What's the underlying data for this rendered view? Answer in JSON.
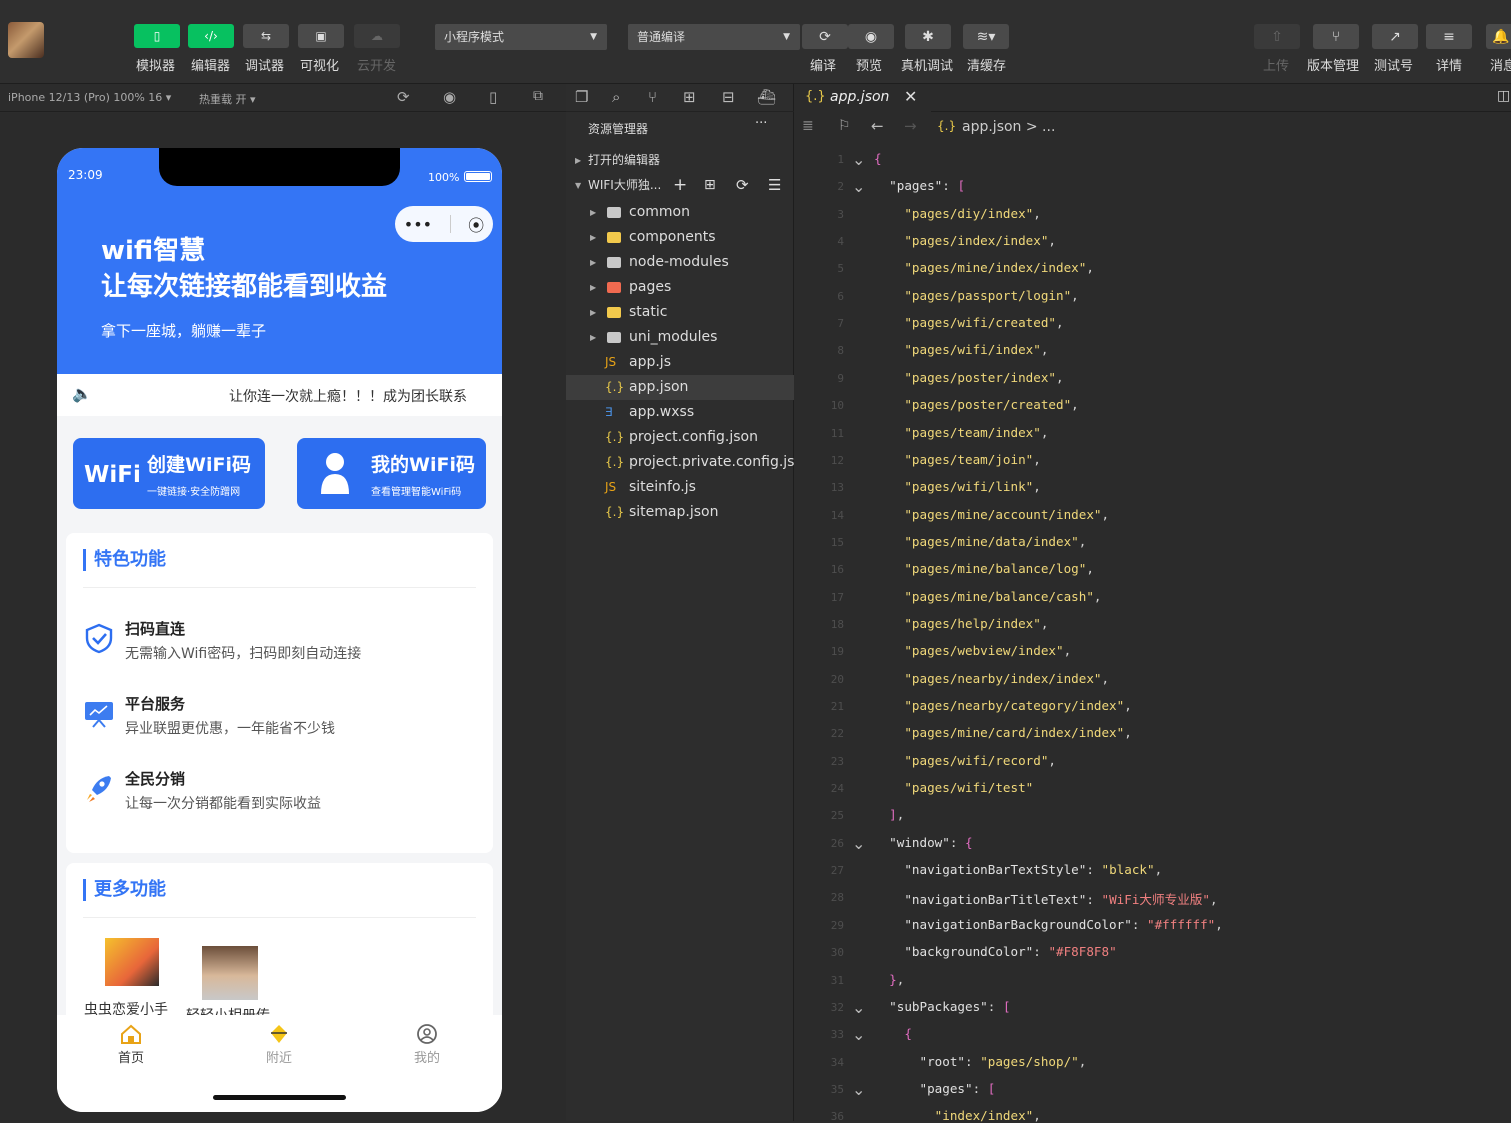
{
  "toolbar": {
    "buttons": [
      {
        "label": "模拟器",
        "icon": "phone-icon"
      },
      {
        "label": "编辑器",
        "icon": "code-icon"
      },
      {
        "label": "调试器",
        "icon": "debug-icon"
      },
      {
        "label": "可视化",
        "icon": "layout-icon"
      },
      {
        "label": "云开发",
        "icon": "cloud-icon"
      }
    ],
    "mode_select": "小程序模式",
    "compile_select": "普通编译",
    "actions": [
      "编译",
      "预览",
      "真机调试",
      "清缓存"
    ],
    "right_actions": [
      "上传",
      "版本管理",
      "测试号",
      "详情",
      "消息"
    ]
  },
  "simulator": {
    "device_info": "iPhone 12/13 (Pro) 100% 16 ▾",
    "hot_reload": "热重载 开 ▾"
  },
  "phone": {
    "time": "23:09",
    "battery": "100%",
    "hero_title": "wifi智慧",
    "hero_subtitle": "让每次链接都能看到收益",
    "hero_caption": "拿下一座城，躺赚一辈子",
    "notice": "让你连一次就上瘾！！！成为团长联系",
    "btn_create": {
      "title": "创建WiFi码",
      "sub": "一键链接·安全防蹭网",
      "logo": "WiFi"
    },
    "btn_mine": {
      "title": "我的WiFi码",
      "sub": "查看管理智能WiFi码"
    },
    "special": {
      "title": "特色功能",
      "items": [
        {
          "title": "扫码直连",
          "desc": "无需输入Wifi密码，扫码即刻自动连接"
        },
        {
          "title": "平台服务",
          "desc": "异业联盟更优惠，一年能省不少钱"
        },
        {
          "title": "全民分销",
          "desc": "让每一次分销都能看到实际收益"
        }
      ]
    },
    "more": {
      "title": "更多功能",
      "items": [
        {
          "label": "虫虫恋爱小手"
        },
        {
          "label": "轻轻小相册传"
        }
      ]
    },
    "tabs": [
      "首页",
      "附近",
      "我的"
    ]
  },
  "explorer": {
    "title": "资源管理器",
    "more": "···",
    "open_editors": "打开的编辑器",
    "project": "WIFI大师独...",
    "items": [
      {
        "label": "common",
        "type": "folder"
      },
      {
        "label": "components",
        "type": "folder"
      },
      {
        "label": "node-modules",
        "type": "folder"
      },
      {
        "label": "pages",
        "type": "folder"
      },
      {
        "label": "static",
        "type": "folder"
      },
      {
        "label": "uni_modules",
        "type": "folder"
      },
      {
        "label": "app.js",
        "type": "js"
      },
      {
        "label": "app.json",
        "type": "json"
      },
      {
        "label": "app.wxss",
        "type": "wxss"
      },
      {
        "label": "project.config.json",
        "type": "json"
      },
      {
        "label": "project.private.config.js...",
        "type": "json"
      },
      {
        "label": "siteinfo.js",
        "type": "js"
      },
      {
        "label": "sitemap.json",
        "type": "json"
      }
    ]
  },
  "editor": {
    "tab": "app.json",
    "breadcrumb": "app.json > ...",
    "lines": [
      "{",
      "  \"pages\": [",
      "    \"pages/diy/index\",",
      "    \"pages/index/index\",",
      "    \"pages/mine/index/index\",",
      "    \"pages/passport/login\",",
      "    \"pages/wifi/created\",",
      "    \"pages/wifi/index\",",
      "    \"pages/poster/index\",",
      "    \"pages/poster/created\",",
      "    \"pages/team/index\",",
      "    \"pages/team/join\",",
      "    \"pages/wifi/link\",",
      "    \"pages/mine/account/index\",",
      "    \"pages/mine/data/index\",",
      "    \"pages/mine/balance/log\",",
      "    \"pages/mine/balance/cash\",",
      "    \"pages/help/index\",",
      "    \"pages/webview/index\",",
      "    \"pages/nearby/index/index\",",
      "    \"pages/nearby/category/index\",",
      "    \"pages/mine/card/index/index\",",
      "    \"pages/wifi/record\",",
      "    \"pages/wifi/test\"",
      "  ],",
      "  \"window\": {",
      "    \"navigationBarTextStyle\": \"black\",",
      "    \"navigationBarTitleText\": \"WiFi大师专业版\",",
      "    \"navigationBarBackgroundColor\": \"#ffffff\",",
      "    \"backgroundColor\": \"#F8F8F8\"",
      "  },",
      "  \"subPackages\": [",
      "    {",
      "      \"root\": \"pages/shop/\",",
      "      \"pages\": [",
      "        \"index/index\","
    ]
  },
  "colors": {
    "accent": "#3475f5",
    "wechat_green": "#07c160",
    "ide_bg": "#2b2b2b"
  }
}
